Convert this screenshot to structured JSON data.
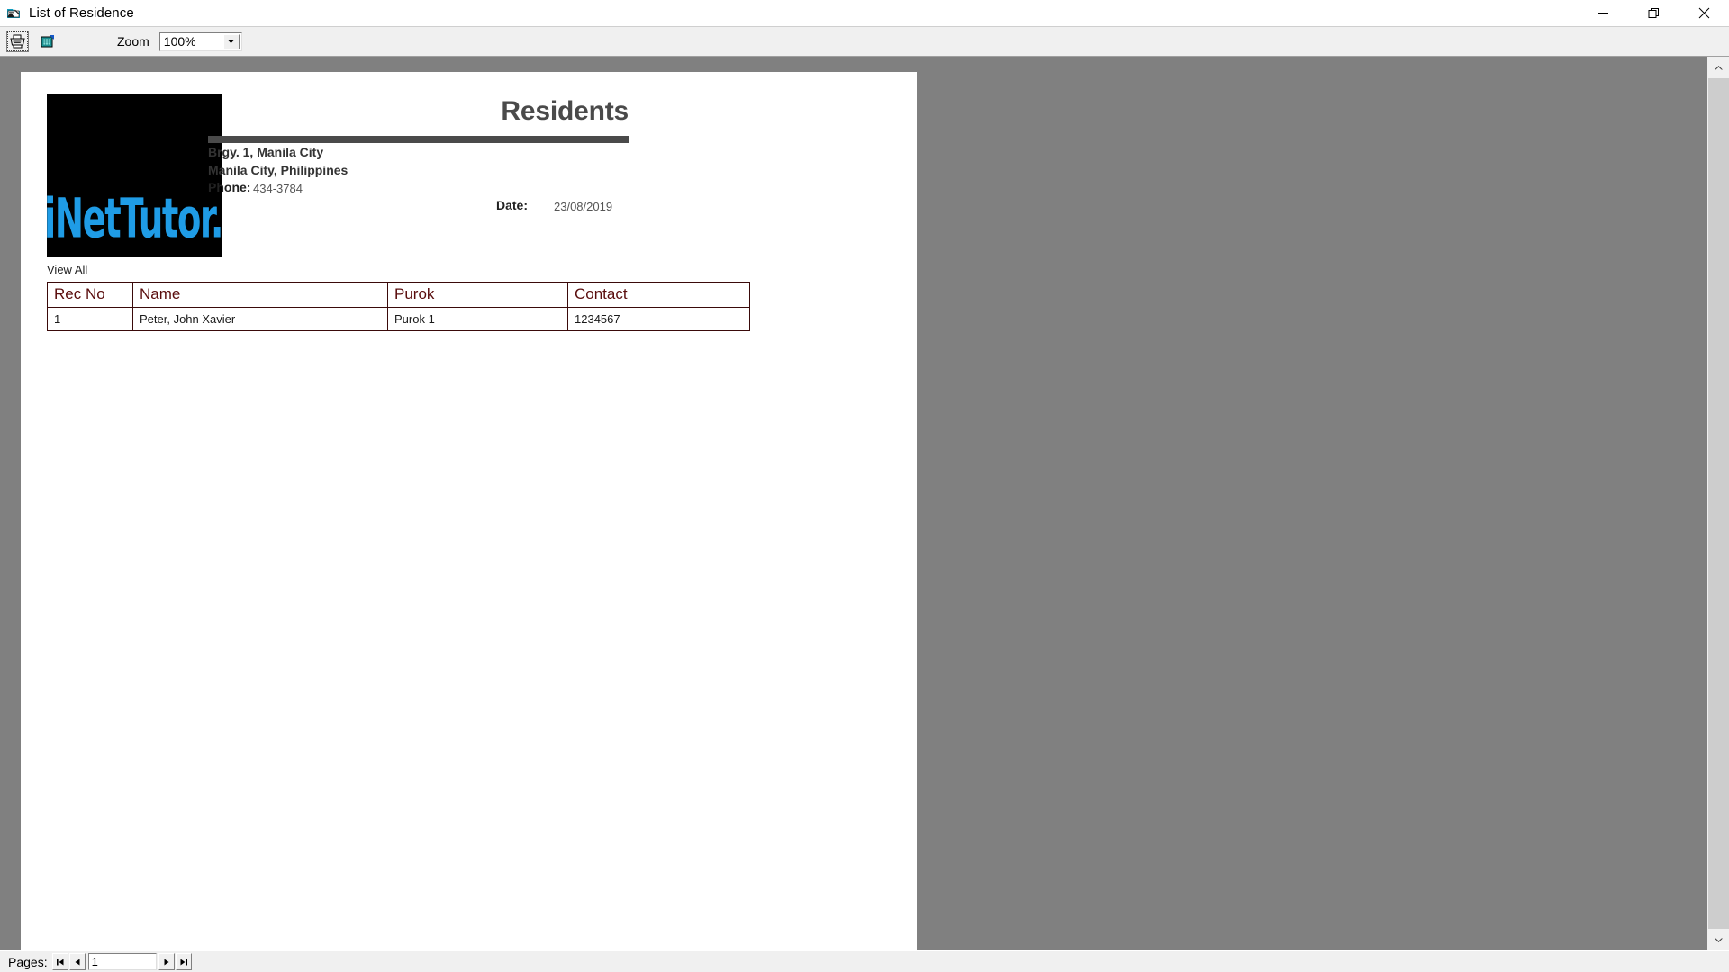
{
  "window": {
    "title": "List of Residence",
    "icon": "report-preview-icon",
    "minimize_label": "Minimize",
    "restore_label": "Restore",
    "close_label": "Close"
  },
  "toolbar": {
    "print_icon": "printer-icon",
    "export_icon": "export-icon",
    "zoom_label": "Zoom",
    "zoom_value": "100%",
    "zoom_dropdown_icon": "chevron-down-icon"
  },
  "report": {
    "logo_text": "iNetTutor.com",
    "title": "Residents",
    "address_line1": "Brgy. 1, Manila City",
    "address_line2": "Manila City, Philippines",
    "phone_label": "Phone:",
    "phone_value": "434-3784",
    "date_label": "Date:",
    "date_value": "23/08/2019",
    "filter_label": "View All",
    "table": {
      "columns": [
        "Rec No",
        "Name",
        "Purok",
        "Contact"
      ],
      "rows": [
        [
          "1",
          "Peter, John Xavier",
          "Purok 1",
          "1234567"
        ]
      ]
    }
  },
  "statusbar": {
    "pages_label": "Pages:",
    "first_icon": "first-page-icon",
    "prev_icon": "previous-page-icon",
    "page_value": "1",
    "next_icon": "next-page-icon",
    "last_icon": "last-page-icon"
  },
  "scrollbar": {
    "up_icon": "scroll-up-icon",
    "down_icon": "scroll-down-icon"
  },
  "colors": {
    "page_background": "#808080",
    "header_rule": "#4a4a4a",
    "table_header_text": "#5a0d0d",
    "logo_blue": "#1f9ce6",
    "toolbar_background": "#f0f0f0"
  }
}
